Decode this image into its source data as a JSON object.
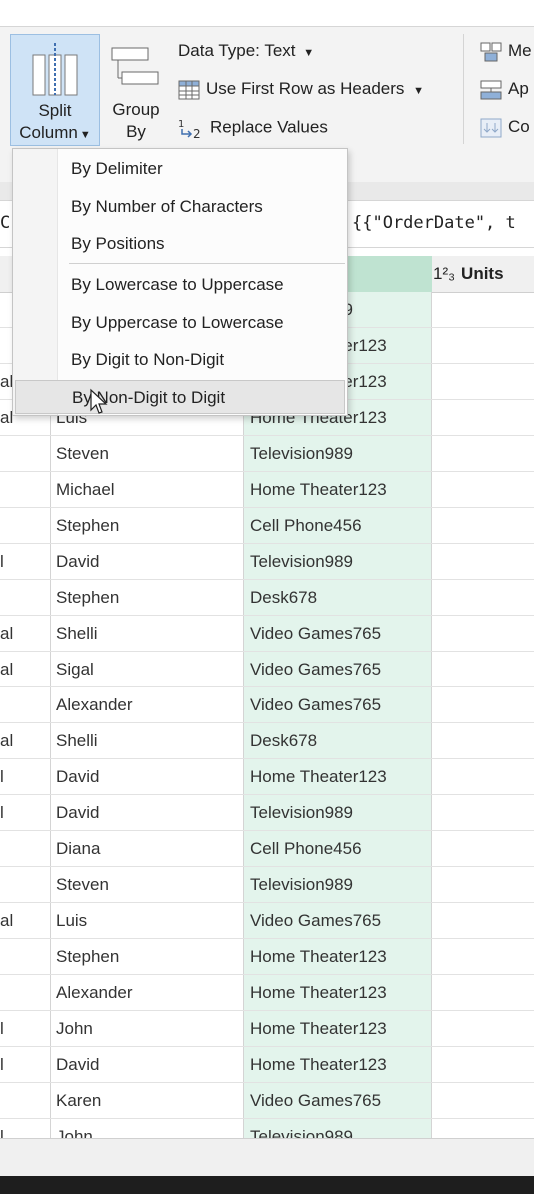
{
  "ribbon": {
    "split_column": {
      "line1": "Split",
      "line2": "Column"
    },
    "group_by": {
      "line1": "Group",
      "line2": "By"
    },
    "data_type": "Data Type: Text",
    "use_first_row": "Use First Row as Headers",
    "replace_values": "Replace Values",
    "right_items": [
      "Me",
      "Ap",
      "Co"
    ]
  },
  "formula": {
    "left_char": "C",
    "text": "{{\"OrderDate\", t"
  },
  "split_menu": {
    "items": [
      "By Delimiter",
      "By Number of Characters",
      "By Positions",
      "By Lowercase to Uppercase",
      "By Uppercase to Lowercase",
      "By Digit to Non-Digit",
      "By Non-Digit to Digit"
    ],
    "hovered": "By Non-Digit to Digit"
  },
  "table": {
    "units_header": "Units",
    "units_type": "1²₃",
    "rows": [
      {
        "c1": "",
        "c2": "",
        "c3": "Television989"
      },
      {
        "c1": "",
        "c2": "",
        "c3": "Home Theater123"
      },
      {
        "c1": "al",
        "c2": "",
        "c3": "Home Theater123"
      },
      {
        "c1": "al",
        "c2": "Luis",
        "c3": "Home Theater123"
      },
      {
        "c1": "",
        "c2": "Steven",
        "c3": "Television989"
      },
      {
        "c1": "",
        "c2": "Michael",
        "c3": "Home Theater123"
      },
      {
        "c1": "",
        "c2": "Stephen",
        "c3": "Cell Phone456"
      },
      {
        "c1": "l",
        "c2": "David",
        "c3": "Television989"
      },
      {
        "c1": "",
        "c2": "Stephen",
        "c3": "Desk678"
      },
      {
        "c1": "al",
        "c2": "Shelli",
        "c3": "Video Games765"
      },
      {
        "c1": "al",
        "c2": "Sigal",
        "c3": "Video Games765"
      },
      {
        "c1": "",
        "c2": "Alexander",
        "c3": "Video Games765"
      },
      {
        "c1": "al",
        "c2": "Shelli",
        "c3": "Desk678"
      },
      {
        "c1": "l",
        "c2": "David",
        "c3": "Home Theater123"
      },
      {
        "c1": "l",
        "c2": "David",
        "c3": "Television989"
      },
      {
        "c1": "",
        "c2": "Diana",
        "c3": "Cell Phone456"
      },
      {
        "c1": "",
        "c2": "Steven",
        "c3": "Television989"
      },
      {
        "c1": "al",
        "c2": "Luis",
        "c3": "Video Games765"
      },
      {
        "c1": "",
        "c2": "Stephen",
        "c3": "Home Theater123"
      },
      {
        "c1": "",
        "c2": "Alexander",
        "c3": "Home Theater123"
      },
      {
        "c1": "l",
        "c2": "John",
        "c3": "Home Theater123"
      },
      {
        "c1": "l",
        "c2": "David",
        "c3": "Home Theater123"
      },
      {
        "c1": "",
        "c2": "Karen",
        "c3": "Video Games765"
      },
      {
        "c1": "l",
        "c2": "John",
        "c3": "Television989"
      }
    ]
  },
  "colors": {
    "accent": "#cfe3f6",
    "column_highlight": "#e3f4ec",
    "header_highlight": "#bfe3d1"
  }
}
